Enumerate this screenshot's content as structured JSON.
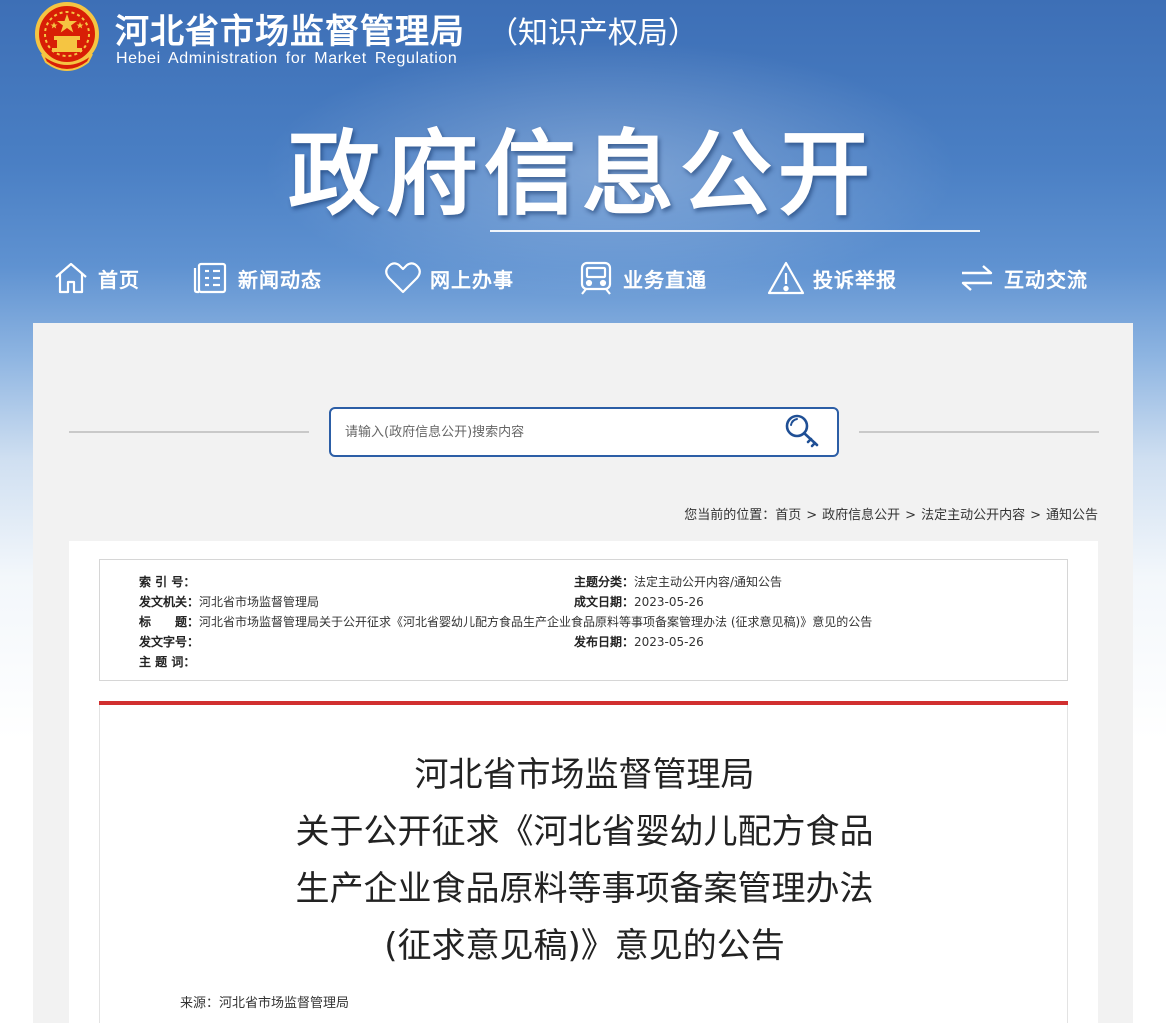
{
  "header": {
    "site_title": "河北省市场监督管理局",
    "site_subtitle": "（知识产权局）",
    "site_en": "Hebei Administration for Market Regulation",
    "banner": "政府信息公开"
  },
  "nav": {
    "items": [
      {
        "label": "首页",
        "icon": "home-icon"
      },
      {
        "label": "新闻动态",
        "icon": "news-icon"
      },
      {
        "label": "网上办事",
        "icon": "heart-icon"
      },
      {
        "label": "业务直通",
        "icon": "train-icon"
      },
      {
        "label": "投诉举报",
        "icon": "warning-icon"
      },
      {
        "label": "互动交流",
        "icon": "exchange-icon"
      }
    ]
  },
  "search": {
    "placeholder": "请输入(政府信息公开)搜索内容",
    "icon": "search-key-icon"
  },
  "breadcrumb": {
    "prefix": "您当前的位置：",
    "items": [
      "首页",
      "政府信息公开",
      "法定主动公开内容",
      "通知公告"
    ],
    "separator": ">"
  },
  "meta": {
    "index_label": "索 引 号：",
    "index_value": "",
    "topic_label": "主题分类：",
    "topic_value": "法定主动公开内容/通知公告",
    "issuer_label": "发文机关：",
    "issuer_value": "河北省市场监督管理局",
    "created_label": "成文日期：",
    "created_value": "2023-05-26",
    "title_label": "标　　题：",
    "title_value": "河北省市场监督管理局关于公开征求《河北省婴幼儿配方食品生产企业食品原料等事项备案管理办法 (征求意见稿)》意见的公告",
    "docno_label": "发文字号：",
    "docno_value": "",
    "published_label": "发布日期：",
    "published_value": "2023-05-26",
    "keywords_label": "主 题 词：",
    "keywords_value": ""
  },
  "article": {
    "title_lines": [
      "河北省市场监督管理局",
      "关于公开征求《河北省婴幼儿配方食品",
      "生产企业食品原料等事项备案管理办法",
      "(征求意见稿)》意见的公告"
    ],
    "source_label": "来源：",
    "source_value": "河北省市场监督管理局"
  },
  "colors": {
    "header_blue": "#3d6fb6",
    "search_border": "#2c5ea6",
    "accent_red": "#d12f2f",
    "panel_gray": "#f2f2f2"
  }
}
